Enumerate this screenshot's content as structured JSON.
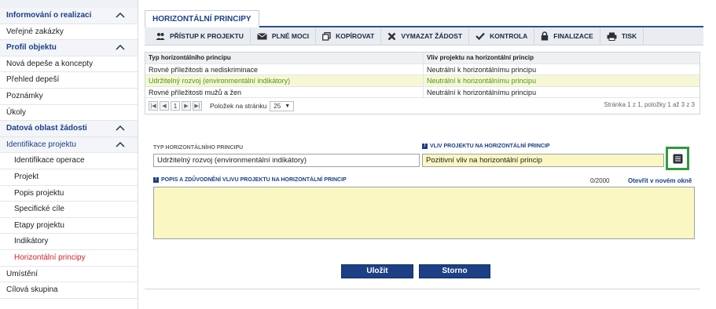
{
  "sidebar": {
    "items": [
      {
        "label": "Informování o realizaci",
        "kind": "section",
        "chevron": true
      },
      {
        "label": "Veřejné zakázky",
        "kind": "item"
      },
      {
        "label": "Profil objektu",
        "kind": "section",
        "chevron": true
      },
      {
        "label": "Nová depeše a koncepty",
        "kind": "item"
      },
      {
        "label": "Přehled depeší",
        "kind": "item"
      },
      {
        "label": "Poznámky",
        "kind": "item"
      },
      {
        "label": "Úkoly",
        "kind": "item"
      },
      {
        "label": "Datová oblast žádosti",
        "kind": "section",
        "chevron": true
      },
      {
        "label": "Identifikace projektu",
        "kind": "open",
        "chevron": true
      },
      {
        "label": "Identifikace operace",
        "kind": "sub"
      },
      {
        "label": "Projekt",
        "kind": "sub"
      },
      {
        "label": "Popis projektu",
        "kind": "sub"
      },
      {
        "label": "Specifické cíle",
        "kind": "sub"
      },
      {
        "label": "Etapy projektu",
        "kind": "sub"
      },
      {
        "label": "Indikátory",
        "kind": "sub"
      },
      {
        "label": "Horizontální principy",
        "kind": "sub-active"
      },
      {
        "label": "Umístění",
        "kind": "item"
      },
      {
        "label": "Cílová skupina",
        "kind": "item"
      }
    ]
  },
  "main": {
    "tab_label": "HORIZONTÁLNÍ PRINCIPY",
    "toolbar": [
      {
        "label": "PŘÍSTUP K PROJEKTU",
        "icon": "people-icon"
      },
      {
        "label": "PLNÉ MOCI",
        "icon": "envelope-icon"
      },
      {
        "label": "KOPÍROVAT",
        "icon": "copy-icon"
      },
      {
        "label": "VYMAZAT ŽÁDOST",
        "icon": "delete-x-icon"
      },
      {
        "label": "KONTROLA",
        "icon": "checkmark-icon"
      },
      {
        "label": "FINALIZACE",
        "icon": "lock-icon"
      },
      {
        "label": "TISK",
        "icon": "printer-icon"
      }
    ],
    "grid": {
      "columns": [
        "Typ horizontálního principu",
        "Vliv projektu na horizontální princip"
      ],
      "rows": [
        {
          "c1": "Rovné příležitosti a nediskriminace",
          "c2": "Neutrální k horizontálnímu principu",
          "selected": false
        },
        {
          "c1": "Udržitelný rozvoj (environmentální indikátory)",
          "c2": "Neutrální k horizontálnímu principu",
          "selected": true
        },
        {
          "c1": "Rovné příležitosti mužů a žen",
          "c2": "Neutrální k horizontálnímu principu",
          "selected": false
        }
      ],
      "pager": {
        "page": "1",
        "per_page_label": "Položek na stránku",
        "per_page_value": "25",
        "info": "Stránka 1 z 1, položky 1 až 3 z 3"
      }
    },
    "form": {
      "type_label": "TYP HORIZONTÁLNÍHO PRINCIPU",
      "type_value": "Udržitelný rozvoj (environmentální indikátory)",
      "impact_label": "VLIV PROJEKTU NA HORIZONTÁLNÍ PRINCIP",
      "impact_value": "Pozitivní vliv na horizontální princip",
      "desc_label": "POPIS A ZDŮVODNĚNÍ VLIVU PROJEKTU NA HORIZONTÁLNÍ PRINCIP",
      "counter": "0/2000",
      "open_new_window": "Otevřít v novém okně",
      "desc_value": ""
    },
    "buttons": {
      "save": "Uložit",
      "cancel": "Storno"
    }
  },
  "colors": {
    "accent_blue": "#1d3f85",
    "active_red": "#d81f26",
    "selected_green": "#4a9a1a",
    "highlight_green": "#2e9b3c",
    "field_yellow": "#fbf7c2"
  }
}
